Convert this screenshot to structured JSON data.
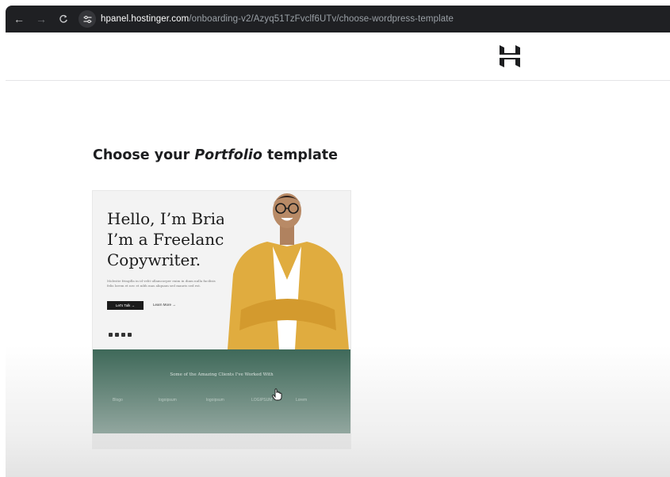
{
  "browser": {
    "url_host": "hpanel.hostinger.com",
    "url_path": "/onboarding-v2/Azyq51TzFvclf6UTv/choose-wordpress-template",
    "back_icon": "←",
    "forward_icon": "→",
    "reload_icon": "C",
    "site_info_icon": "⚙"
  },
  "header": {
    "logo": "hostinger-logo"
  },
  "main": {
    "heading_prefix": "Choose your ",
    "heading_emphasis": "Portfolio",
    "heading_suffix": " template"
  },
  "template_card": {
    "hero_title": "Hello, I’m Brian.\nI’m a Freelance\nCopywriter.",
    "hero_body": "Molestie fringilla in id velit ullamcorper enim in diam nulla facilisis felis lorem et nec et nibh mas aliquam sed mauris sed est.",
    "cta_label": "Let's Talk →",
    "learn_more_label": "Learn More →",
    "clients_title": "Some of the Amazing Clients I've Worked With",
    "client_logos": [
      "Blogo",
      "logoipsum",
      "logoipsum",
      "LOGIPSUM",
      "Lorem"
    ]
  },
  "colors": {
    "browser_bar": "#1f2023",
    "clients_band": "#3b6656",
    "heading_text": "#1d1e20"
  }
}
